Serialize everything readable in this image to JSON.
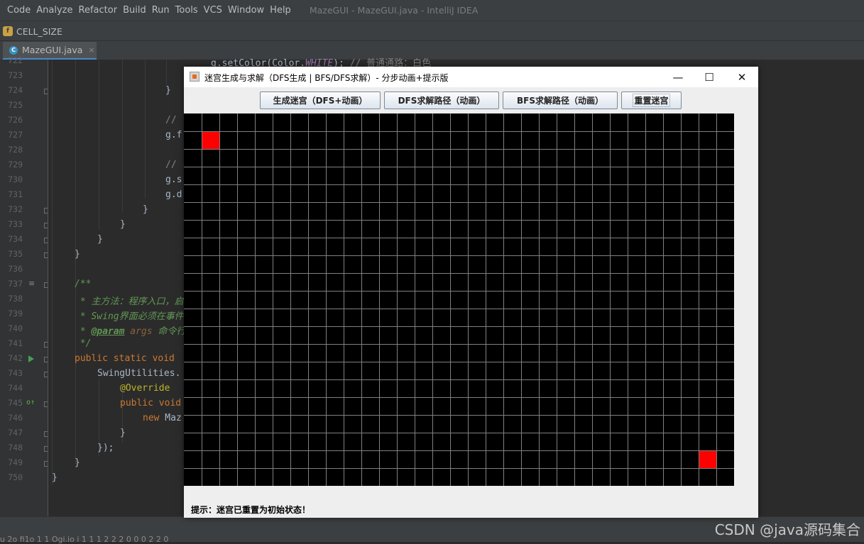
{
  "ide": {
    "menu": [
      "Code",
      "Analyze",
      "Refactor",
      "Build",
      "Run",
      "Tools",
      "VCS",
      "Window",
      "Help"
    ],
    "window_title": "MazeGUI - MazeGUI.java - IntelliJ IDEA",
    "breadcrumb": "CELL_SIZE",
    "tab": {
      "label": "MazeGUI.java",
      "close": "×"
    },
    "line_numbers": [
      "722",
      "723",
      "724",
      "725",
      "726",
      "727",
      "728",
      "729",
      "730",
      "731",
      "732",
      "733",
      "734",
      "735",
      "736",
      "737",
      "738",
      "739",
      "740",
      "741",
      "742",
      "743",
      "744",
      "745",
      "746",
      "747",
      "748",
      "749",
      "750"
    ],
    "code_lines": {
      "l722": {
        "a": "g.setColor(Color.",
        "b": "WHITE",
        "c": "); ",
        "d": "// 普通通路：白色"
      },
      "l724": "}",
      "l726": "//",
      "l727": "g.f",
      "l729": "//",
      "l730": "g.s",
      "l731": "g.d",
      "l732": "}",
      "l733": "}",
      "l734": "}",
      "l735": "}",
      "l737": "/**",
      "l738": " * 主方法：程序入口，启",
      "l739": " * Swing界面必须在事件",
      "l740": {
        "star": " * ",
        "tag": "@param",
        "arg": " args",
        "rest": " 命令行"
      },
      "l741": " */",
      "l742": {
        "kw": "public static void",
        "rest": " "
      },
      "l743": "SwingUtilities.",
      "l744": "@Override",
      "l745": {
        "kw": "public void",
        "rest": ""
      },
      "l746": {
        "kw": "new",
        "rest": " Maz"
      },
      "l747": "}",
      "l748": {
        "a": "});",
        "b": ""
      },
      "l749": "}",
      "l750": "}"
    },
    "status_text": "u 2o fi1o 1 1 Ogi.io i 1 1 1 2 2 2 0 0 0 2 2 0",
    "watermark": "CSDN @java源码集合"
  },
  "swing": {
    "title": "迷宫生成与求解（DFS生成 | BFS/DFS求解）- 分步动画+提示版",
    "controls": {
      "minimize": "—",
      "maximize": "☐",
      "close": "✕"
    },
    "buttons": [
      "生成迷宫（DFS+动画）",
      "DFS求解路径（动画）",
      "BFS求解路径（动画）",
      "重置迷宫"
    ],
    "hint": "提示：迷宫已重置为初始状态！",
    "maze": {
      "cols": 31,
      "rows": 21,
      "start": [
        1,
        1
      ],
      "end": [
        29,
        19
      ],
      "wall_color": "#000000",
      "grid_color": "#808080",
      "marker_color": "#ff0000"
    }
  }
}
